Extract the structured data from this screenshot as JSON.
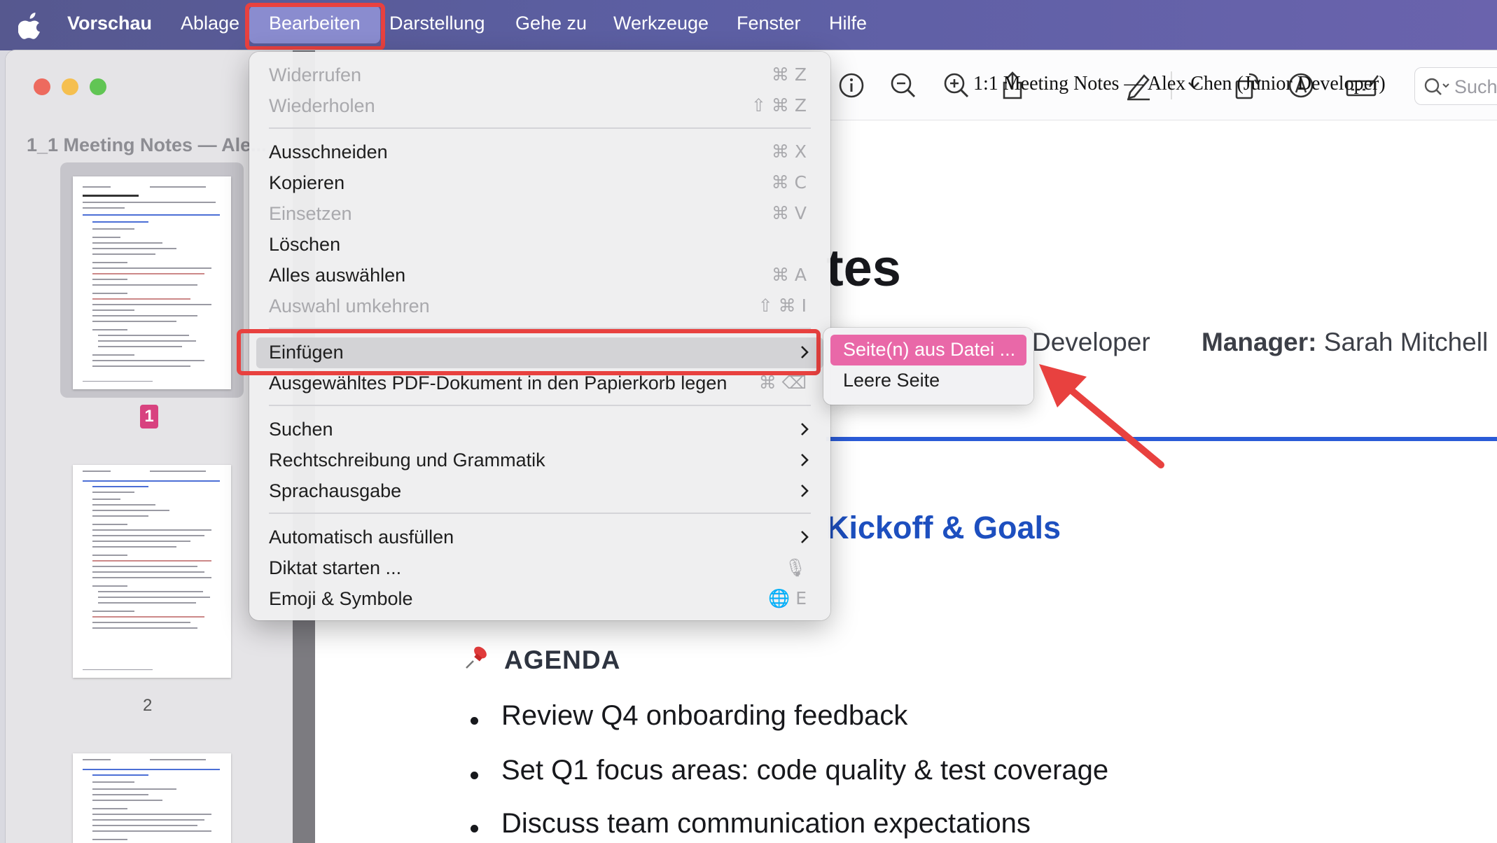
{
  "menubar": {
    "app_name": "Vorschau",
    "items": [
      "Ablage",
      "Bearbeiten",
      "Darstellung",
      "Gehe zu",
      "Werkzeuge",
      "Fenster",
      "Hilfe"
    ],
    "active": "Bearbeiten"
  },
  "sidebar": {
    "doc_title": "1_1 Meeting Notes — Ale...",
    "pages": [
      {
        "number": "1",
        "selected": true
      },
      {
        "number": "2",
        "selected": false
      }
    ]
  },
  "toolbar": {
    "search_placeholder": "Suche"
  },
  "edit_menu": {
    "items": [
      {
        "label": "Widerrufen",
        "shortcut": "⌘ Z",
        "disabled": true
      },
      {
        "label": "Wiederholen",
        "shortcut": "⇧ ⌘ Z",
        "disabled": true
      },
      {
        "label": "Ausschneiden",
        "shortcut": "⌘ X",
        "disabled": false
      },
      {
        "label": "Kopieren",
        "shortcut": "⌘ C",
        "disabled": false
      },
      {
        "label": "Einsetzen",
        "shortcut": "⌘ V",
        "disabled": true
      },
      {
        "label": "Löschen",
        "shortcut": "",
        "disabled": false
      },
      {
        "label": "Alles auswählen",
        "shortcut": "⌘ A",
        "disabled": false
      },
      {
        "label": "Auswahl umkehren",
        "shortcut": "⇧ ⌘ I",
        "disabled": true
      },
      {
        "label": "Einfügen",
        "shortcut": "",
        "submenu": true,
        "highlighted": true
      },
      {
        "label": "Ausgewähltes PDF-Dokument in den Papierkorb legen",
        "shortcut": "⌘ ⌫",
        "disabled": false
      },
      {
        "label": "Suchen",
        "submenu": true
      },
      {
        "label": "Rechtschreibung und Grammatik",
        "submenu": true
      },
      {
        "label": "Sprachausgabe",
        "submenu": true
      },
      {
        "label": "Automatisch ausfüllen",
        "submenu": true
      },
      {
        "label": "Diktat starten ...",
        "shortcut": "🎙"
      },
      {
        "label": "Emoji & Symbole",
        "shortcut": "🌐 E"
      }
    ]
  },
  "insert_submenu": {
    "items": [
      "Seite(n) aus Datei ...",
      "Leere Seite"
    ],
    "highlighted": "Seite(n) aus Datei ..."
  },
  "document": {
    "header": "1:1 Meeting Notes — Alex Chen (Junior Developer)",
    "title_fragment": "tes",
    "meta_fragment": "Developer",
    "manager_label": "Manager:",
    "manager_name": "Sarah Mitchell",
    "section_fragment": "Kickoff & Goals",
    "agenda_label": "AGENDA",
    "agenda_items": [
      "Review Q4 onboarding feedback",
      "Set Q1 focus areas: code quality & test coverage",
      "Discuss team communication expectations"
    ]
  },
  "colors": {
    "menubar": "#5c5fa3",
    "active_menu": "#8a8ccf",
    "callout_red": "#e8413f",
    "submenu_highlight": "#e968a8",
    "section_blue": "#1d4fbf"
  }
}
